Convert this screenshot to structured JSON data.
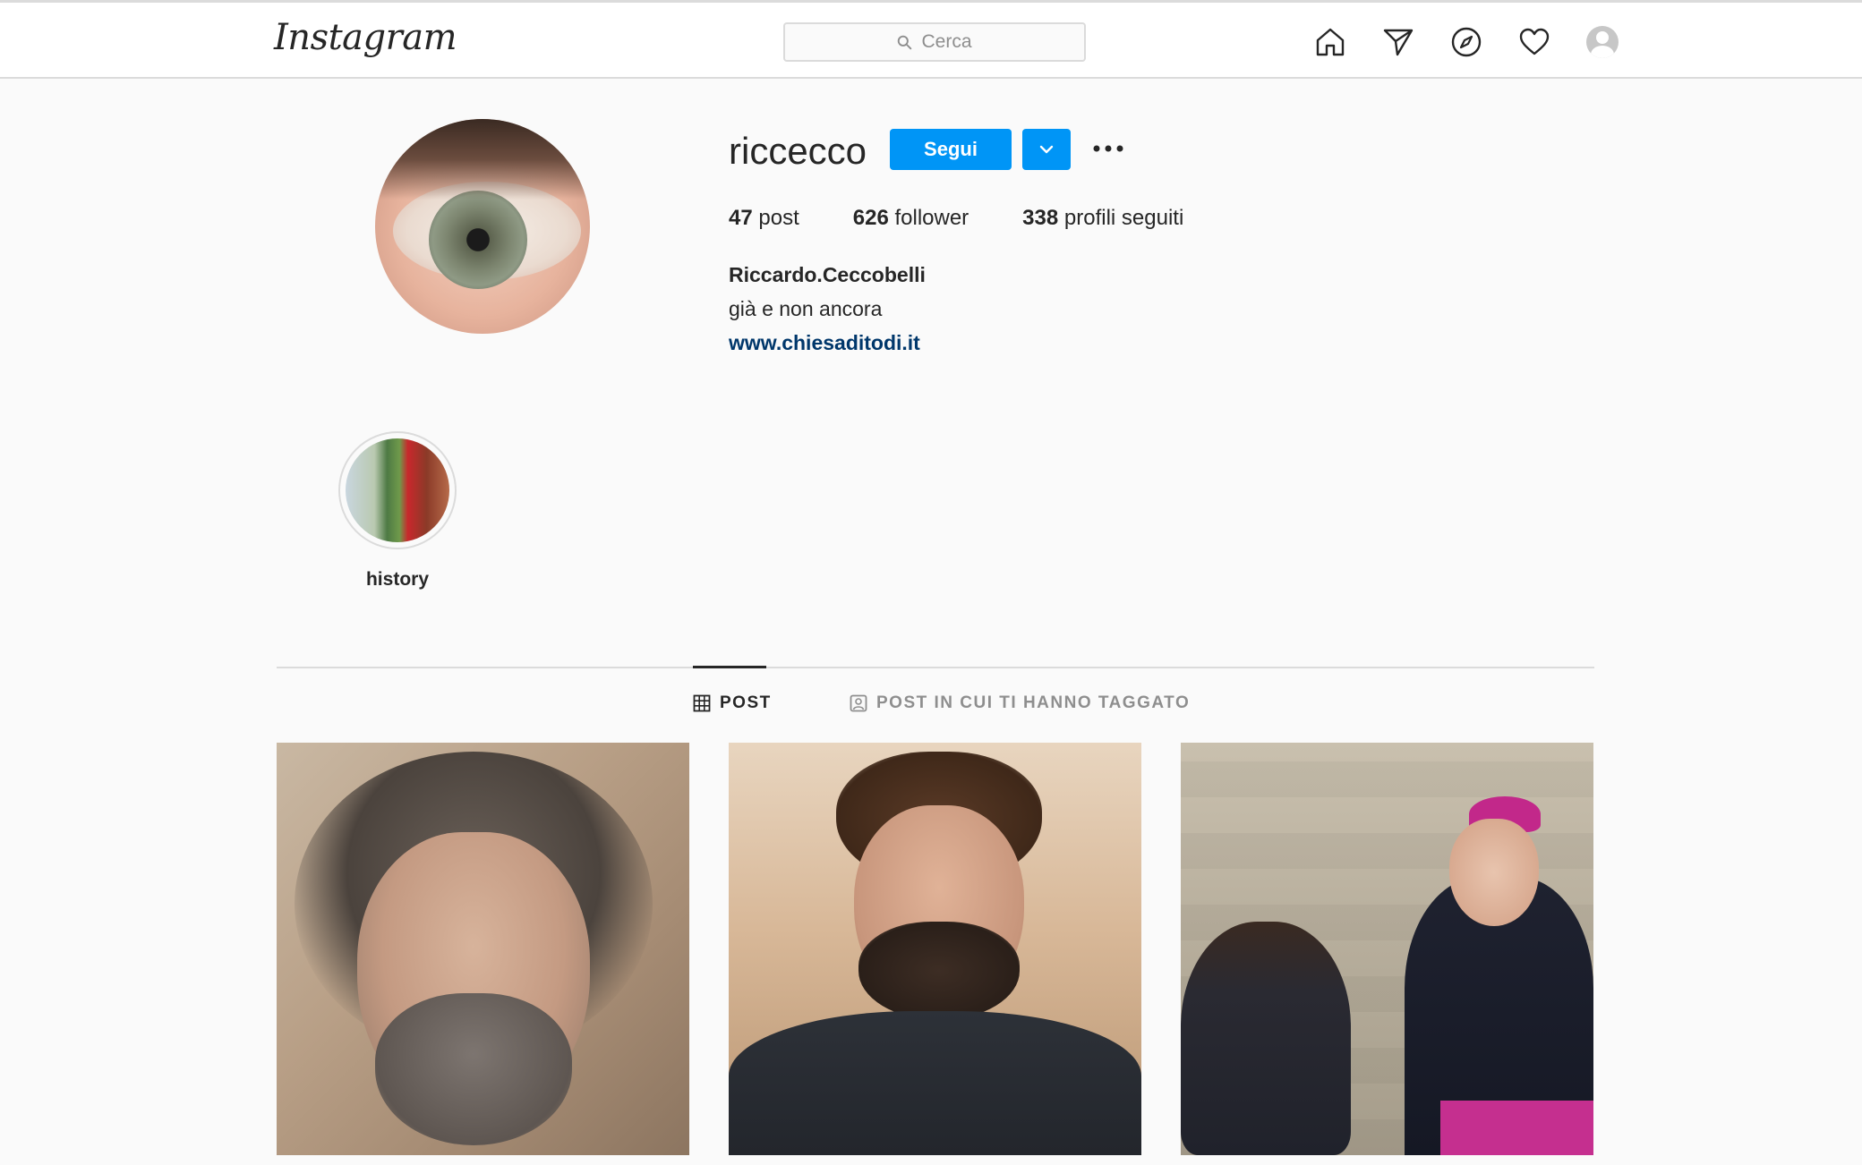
{
  "topbar": {
    "logo": "Instagram",
    "search_placeholder": "Cerca"
  },
  "profile": {
    "username": "riccecco",
    "follow_label": "Segui",
    "stats": {
      "posts_count": "47",
      "posts_label": "post",
      "followers_count": "626",
      "followers_label": "follower",
      "following_count": "338",
      "following_label": "profili seguiti"
    },
    "full_name": "Riccardo.Ceccobelli",
    "bio": "già e non ancora",
    "website": "www.chiesaditodi.it"
  },
  "highlights": [
    {
      "label": "history"
    }
  ],
  "tabs": [
    {
      "label": "POST",
      "active": true
    },
    {
      "label": "POST IN CUI TI HANNO TAGGATO",
      "active": false
    }
  ],
  "colors": {
    "primary_button": "#0095f6",
    "link": "#00376b",
    "background": "#fafafa"
  }
}
